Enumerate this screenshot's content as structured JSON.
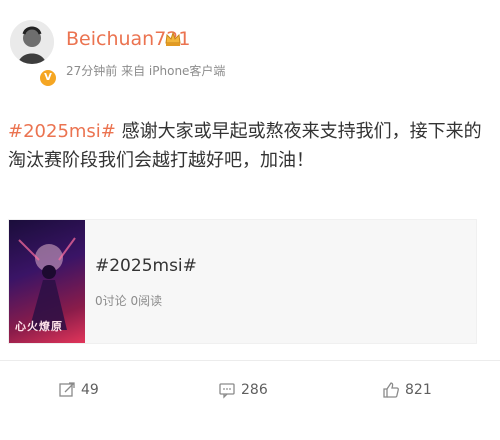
{
  "post": {
    "username": "Beichuan721",
    "time": "27分钟前",
    "source": "来自 iPhone客户端",
    "hashtag": "#2025msi#",
    "text": " 感谢大家或早起或熬夜来支持我们，接下来的淘汰赛阶段我们会越打越好吧，加油！"
  },
  "card": {
    "title": "#2025msi#",
    "stats": "0讨论 0阅读",
    "image_text": "心火燎原"
  },
  "actions": {
    "shares": "49",
    "comments": "286",
    "likes": "821"
  },
  "colors": {
    "accent": "#eb7350",
    "text": "#333333",
    "muted": "#8c8c8c"
  }
}
